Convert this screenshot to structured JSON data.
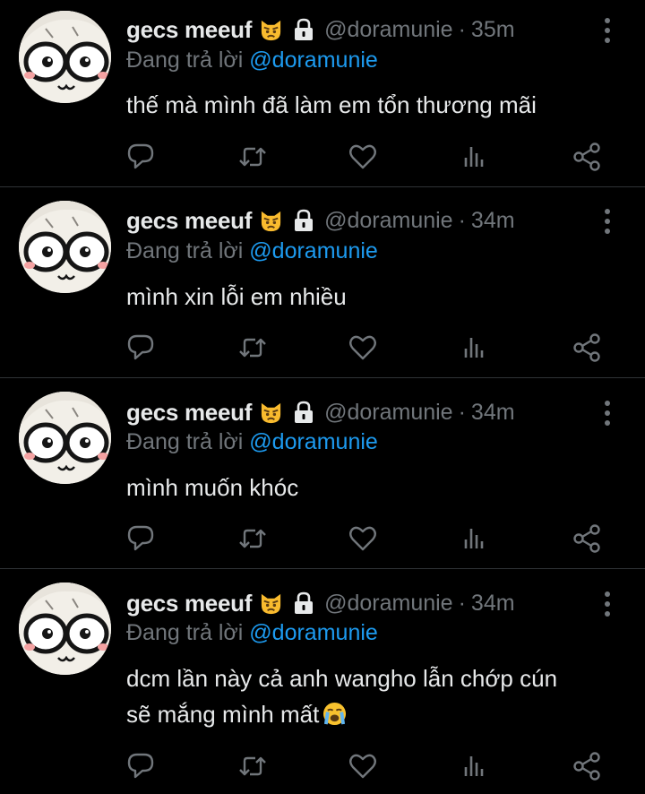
{
  "colors": {
    "background": "#000000",
    "text": "#e7e9ea",
    "muted": "#71767b",
    "mention": "#1d9bf0",
    "divider": "#2f3336"
  },
  "tweets": [
    {
      "name": "gecs meeuf",
      "handle": "@doramunie",
      "sep": "·",
      "time": "35m",
      "reply_prefix": "Đang trả lời",
      "reply_to": "@doramunie",
      "lines": [
        "thế mà mình đã làm em tổn thương mãi"
      ]
    },
    {
      "name": "gecs meeuf",
      "handle": "@doramunie",
      "sep": "·",
      "time": "34m",
      "reply_prefix": "Đang trả lời",
      "reply_to": "@doramunie",
      "lines": [
        "mình xin lỗi em nhiều"
      ]
    },
    {
      "name": "gecs meeuf",
      "handle": "@doramunie",
      "sep": "·",
      "time": "34m",
      "reply_prefix": "Đang trả lời",
      "reply_to": "@doramunie",
      "lines": [
        "mình muốn khóc"
      ]
    },
    {
      "name": "gecs meeuf",
      "handle": "@doramunie",
      "sep": "·",
      "time": "34m",
      "reply_prefix": "Đang trả lời",
      "reply_to": "@doramunie",
      "lines": [
        "dcm lần này cả anh wangho lẫn chớp cún",
        "sẽ mắng mình mất"
      ],
      "trailing_emoji": "loudly-crying-face-emoji"
    }
  ],
  "icons": {
    "name_badge": "pouting-cat-emoji",
    "protected": "lock-icon",
    "more": "more-vertical-icon",
    "reply": "reply-icon",
    "retweet": "retweet-icon",
    "like": "heart-icon",
    "views": "views-icon",
    "share": "share-icon"
  }
}
